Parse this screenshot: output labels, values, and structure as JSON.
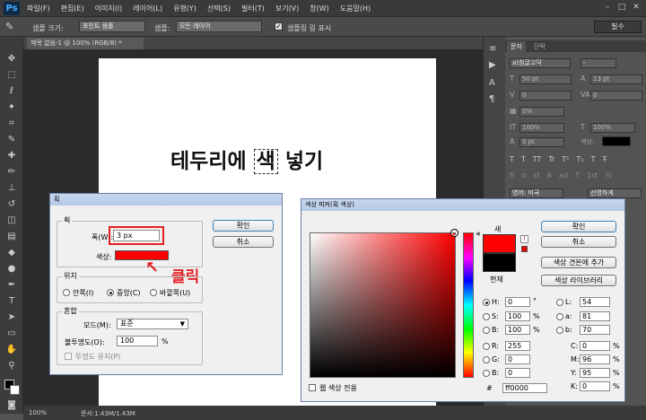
{
  "menubar": {
    "logo": "Ps",
    "items": [
      "파일(F)",
      "편집(E)",
      "이미지(I)",
      "레이어(L)",
      "유형(Y)",
      "선택(S)",
      "필터(T)",
      "보기(V)",
      "창(W)",
      "도움말(H)"
    ]
  },
  "options": {
    "sample_size_label": "샘플 크기:",
    "sample_size_value": "포인트 샘플",
    "sample_label": "샘플:",
    "sample_value": "모든 레이어",
    "show_ring_label": "샘플링 링 표시",
    "essential": "필수"
  },
  "document": {
    "tab_title": "제목 없음-1 @ 100% (RGB/8) *",
    "headline_before": "테두리에 ",
    "headline_selected": "색",
    "headline_after": " 넣기"
  },
  "statusbar": {
    "zoom": "100%",
    "doc_info": "문서:1.43M/1.43M"
  },
  "character_panel": {
    "tab_char": "문자",
    "tab_para": "단락",
    "font_family": "a)침글고딕",
    "font_style": "-",
    "size": "50 pt",
    "leading": "13 pt",
    "kerning": "0",
    "tracking": "0",
    "scale_pct": "0%",
    "vscale": "100%",
    "hscale": "100%",
    "baseline": "0 pt",
    "color_label": "색상:",
    "color_value": "#000000",
    "language": "영어: 미국",
    "aa": "선명하게",
    "glyphs": [
      "T",
      "T",
      "TT",
      "Tr",
      "T¹",
      "T₁",
      "T",
      "Ŧ"
    ],
    "glyphs2": [
      "fi",
      "σ",
      "st",
      "A",
      "ad",
      "T",
      "1st",
      "½"
    ]
  },
  "stroke_dialog": {
    "title": "획",
    "group_stroke": "획",
    "width_label": "폭(W):",
    "width_value": "3 px",
    "color_label": "색상:",
    "stroke_color": "#ff0000",
    "ok": "확인",
    "cancel": "취소",
    "group_location": "위치",
    "loc_inside": "안쪽(I)",
    "loc_center": "중앙(C)",
    "loc_outside": "바깥쪽(U)",
    "group_blend": "혼합",
    "mode_label": "모드(M):",
    "mode_value": "표준",
    "opacity_label": "불투명도(O):",
    "opacity_value": "100",
    "opacity_unit": "%",
    "preserve_label": "투명도 유지(P)",
    "annotation": "클릭"
  },
  "color_picker": {
    "title": "색상 피커(획 색상)",
    "new_label": "새",
    "current_label": "현재",
    "new_color": "#ff0000",
    "current_color": "#000000",
    "ok": "확인",
    "cancel": "취소",
    "add_swatch": "색상 견본에 추가",
    "libraries": "색상 라이브러리",
    "web_only": "웹 색상 전용",
    "hsb": [
      {
        "label": "H:",
        "value": "0",
        "unit": "°"
      },
      {
        "label": "S:",
        "value": "100",
        "unit": "%"
      },
      {
        "label": "B:",
        "value": "100",
        "unit": "%"
      }
    ],
    "rgb": [
      {
        "label": "R:",
        "value": "255"
      },
      {
        "label": "G:",
        "value": "0"
      },
      {
        "label": "B:",
        "value": "0"
      }
    ],
    "lab": [
      {
        "label": "L:",
        "value": "54"
      },
      {
        "label": "a:",
        "value": "81"
      },
      {
        "label": "b:",
        "value": "70"
      }
    ],
    "cmyk": [
      {
        "label": "C:",
        "value": "0",
        "unit": "%"
      },
      {
        "label": "M:",
        "value": "96",
        "unit": "%"
      },
      {
        "label": "Y:",
        "value": "95",
        "unit": "%"
      },
      {
        "label": "K:",
        "value": "0",
        "unit": "%"
      }
    ],
    "hex_label": "#",
    "hex_value": "ff0000"
  }
}
